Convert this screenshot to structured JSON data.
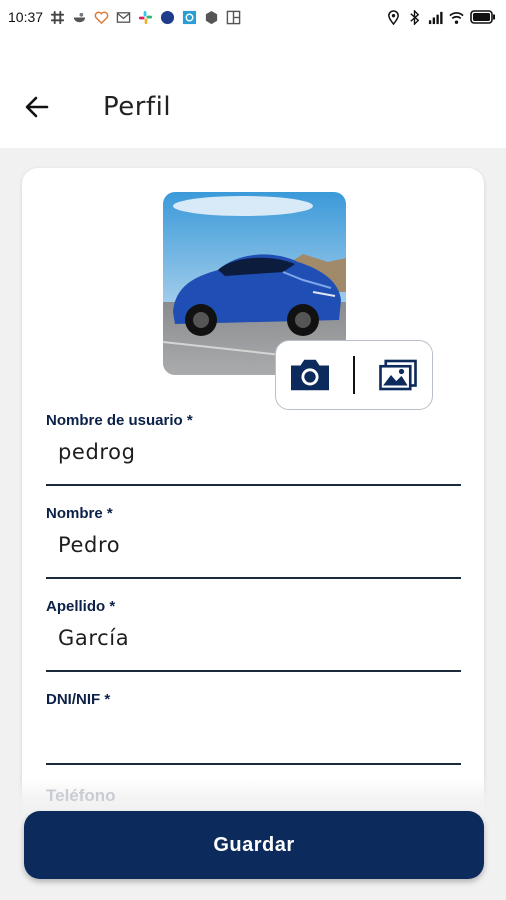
{
  "status_bar": {
    "time": "10:37",
    "left_icons": [
      "slack-icon",
      "bowl-icon",
      "heart-icon",
      "gmail-icon",
      "slack-icon",
      "circle-app-icon",
      "square-app-icon",
      "hexagon-app-icon",
      "board-icon"
    ],
    "right_icons": [
      "location-icon",
      "bluetooth-icon",
      "signal-icon",
      "wifi-icon",
      "battery-icon"
    ]
  },
  "header": {
    "title": "Perfil",
    "back_icon": "arrow-left-icon"
  },
  "profile": {
    "photo_icon": "car-photo",
    "camera_icon": "camera-icon",
    "gallery_icon": "gallery-icon"
  },
  "form": {
    "username": {
      "label": "Nombre de usuario *",
      "value": "pedrog"
    },
    "name": {
      "label": "Nombre *",
      "value": "Pedro"
    },
    "surname": {
      "label": "Apellido *",
      "value": "García"
    },
    "dni": {
      "label": "DNI/NIF *",
      "value": ""
    },
    "phone": {
      "label": "Teléfono"
    }
  },
  "actions": {
    "save_label": "Guardar"
  },
  "colors": {
    "accent": "#0c2a5c",
    "label": "#0c2148",
    "background": "#f1f1f1"
  }
}
